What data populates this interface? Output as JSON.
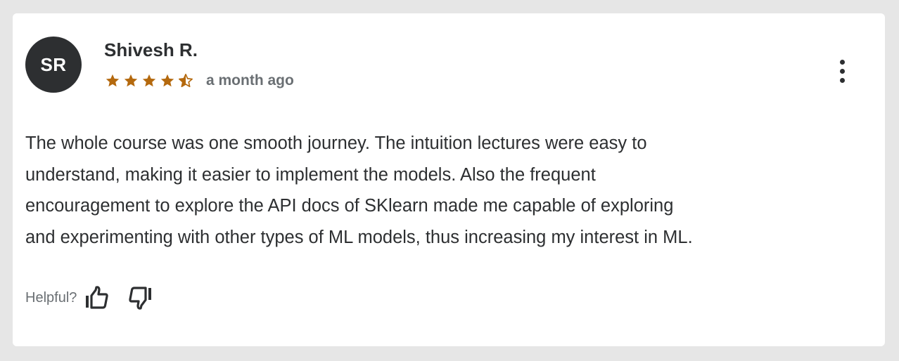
{
  "reviewer": {
    "initials": "SR",
    "name": "Shivesh R."
  },
  "rating": {
    "value": 4.5,
    "max": 5,
    "star_color": "#b4690e"
  },
  "time_ago": "a month ago",
  "review_text": [
    "The whole course was one smooth journey. The intuition lectures were easy to",
    "understand, making it easier to implement the models. Also the frequent",
    "encouragement to explore the API docs of SKlearn made me capable of exploring",
    "and experimenting with other types of ML models, thus increasing my interest in ML."
  ],
  "helpful": {
    "label": "Helpful?",
    "up_icon": "thumbs-up-icon",
    "down_icon": "thumbs-down-icon"
  },
  "menu_icon": "more-vertical-icon",
  "colors": {
    "avatar_bg": "#2d2f31",
    "text_primary": "#2d2f31",
    "text_secondary": "#6a6f73",
    "page_bg": "#e6e6e6",
    "card_bg": "#ffffff"
  }
}
